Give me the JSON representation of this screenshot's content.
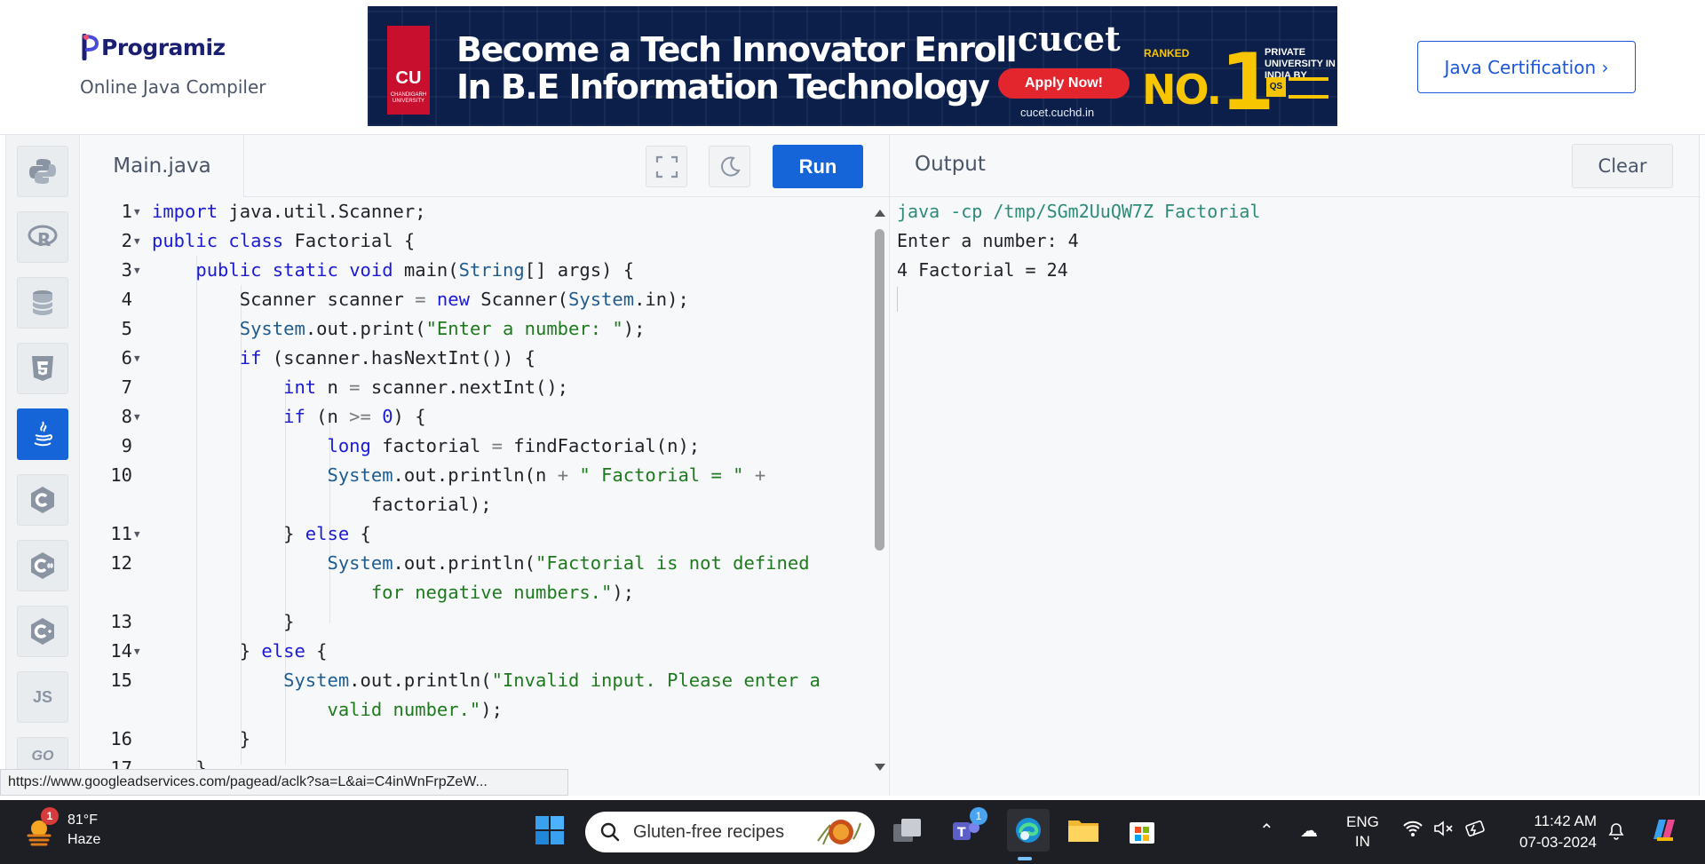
{
  "header": {
    "logo_text": "Programiz",
    "subtitle": "Online Java Compiler",
    "cta_label": "Java Certification ›"
  },
  "ad": {
    "university_badge": "CU",
    "university_badge_sub": "CHANDIGARH UNIVERSITY",
    "headline_line1": "Become a Tech Innovator Enroll",
    "headline_line2": "In B.E Information Technology",
    "brand": "cucet",
    "apply_label": "Apply Now!",
    "url": "cucet.cuchd.in",
    "ranked": "RANKED",
    "rank_no": "NO.",
    "rank_digit": "1",
    "private_line": "PRIVATE UNIVERSITY IN INDIA BY",
    "qs_label": "QS"
  },
  "sidebar": {
    "items": [
      {
        "name": "python",
        "icon": "python-icon"
      },
      {
        "name": "r",
        "icon": "r-icon"
      },
      {
        "name": "sql",
        "icon": "database-icon"
      },
      {
        "name": "html",
        "icon": "html5-icon"
      },
      {
        "name": "java",
        "icon": "java-icon",
        "active": true
      },
      {
        "name": "c",
        "icon": "c-icon"
      },
      {
        "name": "csharp",
        "icon": "csharp-icon"
      },
      {
        "name": "cpp",
        "icon": "cpp-icon"
      },
      {
        "name": "js",
        "label": "JS"
      },
      {
        "name": "go",
        "label": "GO"
      }
    ]
  },
  "editor": {
    "file_tab": "Main.java",
    "run_label": "Run"
  },
  "output": {
    "title": "Output",
    "clear_label": "Clear",
    "lines": [
      "java -cp /tmp/SGm2UuQW7Z Factorial",
      "Enter a number: 4",
      "4 Factorial = 24"
    ]
  },
  "status_link": "https://www.googleadservices.com/pagead/aclk?sa=L&ai=C4inWnFrpZeW...",
  "taskbar": {
    "weather_badge": "1",
    "temperature": "81°F",
    "condition": "Haze",
    "search_text": "Gluten-free recipes",
    "teams_badge": "1",
    "lang_top": "ENG",
    "lang_bottom": "IN",
    "time": "11:42 AM",
    "date": "07-03-2024"
  },
  "colors": {
    "accent": "#1565d8",
    "keyword": "#1b1bd6",
    "string": "#1d7a1d",
    "class": "#1f5c8f",
    "taskbar": "#1e1f24"
  }
}
